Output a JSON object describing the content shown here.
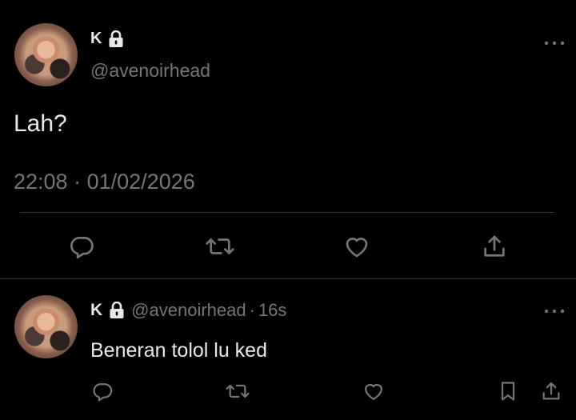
{
  "main_tweet": {
    "display_name": "K",
    "handle": "@avenoirhead",
    "text": "Lah?",
    "time": "22:08",
    "separator": "·",
    "date": "01/02/2026"
  },
  "reply": {
    "display_name": "K",
    "handle": "@avenoirhead",
    "separator": "·",
    "age": "16s",
    "text": "Beneran tolol lu ked"
  },
  "icons": {
    "more": "more-horizontal-icon",
    "lock": "lock-icon",
    "reply": "reply-icon",
    "retweet": "retweet-icon",
    "like": "heart-icon",
    "share": "share-icon",
    "bookmark": "bookmark-icon"
  },
  "colors": {
    "background": "#000000",
    "text": "#e7e9ea",
    "muted": "#71767b",
    "divider": "#2f3336"
  }
}
